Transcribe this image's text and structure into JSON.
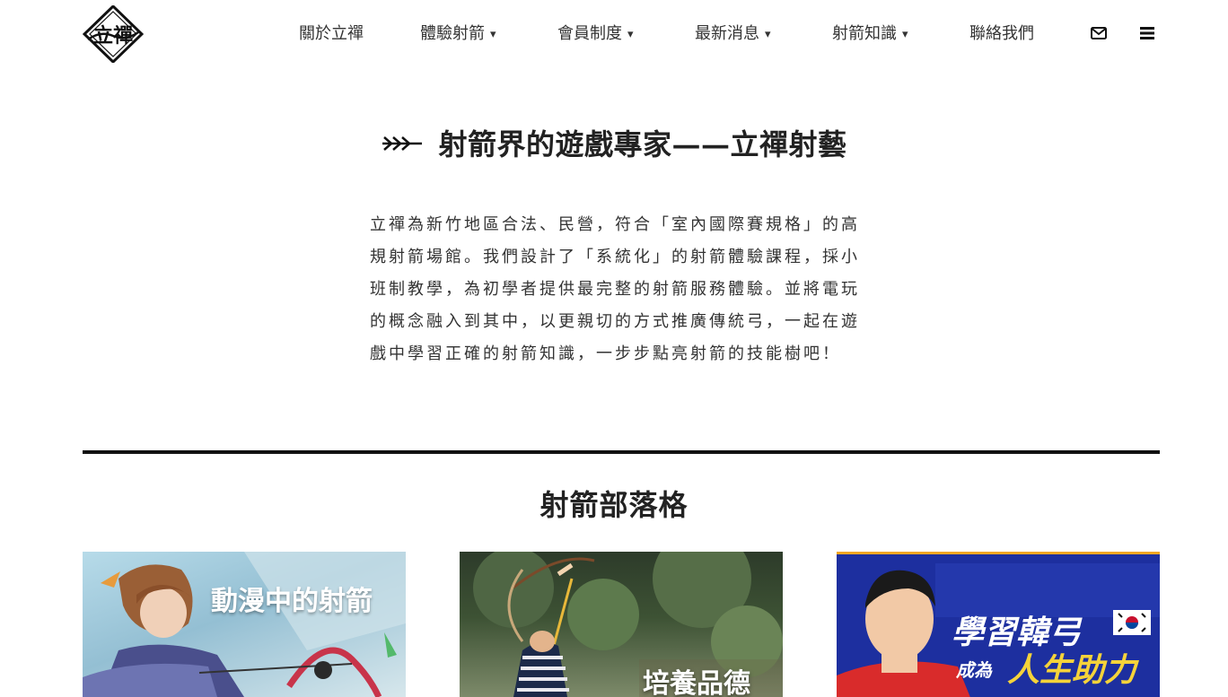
{
  "brand": {
    "logo_text": "立禪"
  },
  "nav": {
    "items": [
      {
        "label": "關於立禪",
        "has_dropdown": false
      },
      {
        "label": "體驗射箭",
        "has_dropdown": true
      },
      {
        "label": "會員制度",
        "has_dropdown": true
      },
      {
        "label": "最新消息",
        "has_dropdown": true
      },
      {
        "label": "射箭知識",
        "has_dropdown": true
      },
      {
        "label": "聯絡我們",
        "has_dropdown": false
      }
    ],
    "caret": "▾",
    "icons": [
      "envelope-icon",
      "menu-icon"
    ]
  },
  "intro": {
    "heading": "射箭界的遊戲專家——立禪射藝",
    "paragraph": "立禪為新竹地區合法、民營，符合「室內國際賽規格」的高規射箭場館。我們設計了「系統化」的射箭體驗課程，採小班制教學，為初學者提供最完整的射箭服務體驗。並將電玩的概念融入到其中，以更親切的方式推廣傳統弓，一起在遊戲中學習正確的射箭知識，一步步點亮射箭的技能樹吧！"
  },
  "blog": {
    "title": "射箭部落格",
    "cards": [
      {
        "label": "動漫中的射箭"
      },
      {
        "label": "培養品德"
      },
      {
        "label_line1": "學習韓弓",
        "label_line2_a": "成為",
        "label_line2_b": "人生助力"
      }
    ]
  },
  "colors": {
    "text": "#222222",
    "divider": "#111111",
    "card3_accent": "#f5a623",
    "card3_blue": "#1d2f9f"
  }
}
